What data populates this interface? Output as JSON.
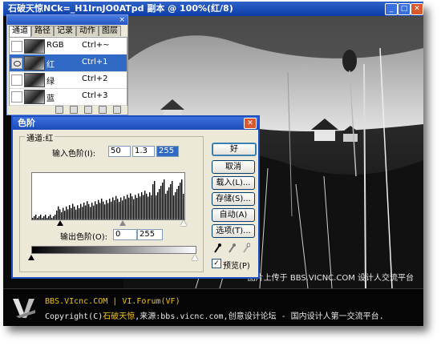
{
  "window": {
    "title": "石破天惊NCk=_H1IrnJO0ATpd 副本 @ 100%(红/8)",
    "min_glyph": "_",
    "max_glyph": "□",
    "close_glyph": "✕"
  },
  "channels_panel": {
    "close_glyph": "×",
    "tabs": [
      "通道",
      "路径",
      "记录",
      "动作",
      "图层"
    ],
    "channels": [
      {
        "name": "RGB",
        "shortcut": "Ctrl+~",
        "visible": false,
        "selected": false
      },
      {
        "name": "红",
        "shortcut": "Ctrl+1",
        "visible": true,
        "selected": true
      },
      {
        "name": "绿",
        "shortcut": "Ctrl+2",
        "visible": false,
        "selected": false
      },
      {
        "name": "蓝",
        "shortcut": "Ctrl+3",
        "visible": false,
        "selected": false
      }
    ]
  },
  "levels_dialog": {
    "title": "色阶",
    "close_glyph": "✕",
    "channel_label": "通道:红",
    "input_label": "输入色阶(I):",
    "input_black": "50",
    "input_gamma": "1.3",
    "input_white": "255",
    "output_label": "输出色阶(O):",
    "output_black": "0",
    "output_white": "255",
    "buttons": {
      "ok": "好",
      "cancel": "取消",
      "load": "载入(L)...",
      "save": "存储(S)...",
      "auto": "自动(A)",
      "options": "选项(T)..."
    },
    "preview_label": "预览(P)",
    "preview_checked": true,
    "check_glyph": "✓"
  },
  "photo": {
    "caption": "图片上传于 BBS.VICNC.COM 设计人交流平台"
  },
  "footer": {
    "line1_a": "BBS.VIcnc.COM",
    "line1_sep": " | ",
    "line1_b": "VI.Forum(VF)",
    "line2_a": "Copyright(C)",
    "line2_name": "石破天惊",
    "line2_b": ",来源:bbs.vicnc.com,创意设计论坛 - 国内设计人第一交流平台."
  },
  "colors": {
    "titlebar": "#0b3ea8",
    "selection": "#316ac5",
    "dialog_bg": "#ece9d8",
    "footer_text": "#f1c40f"
  }
}
